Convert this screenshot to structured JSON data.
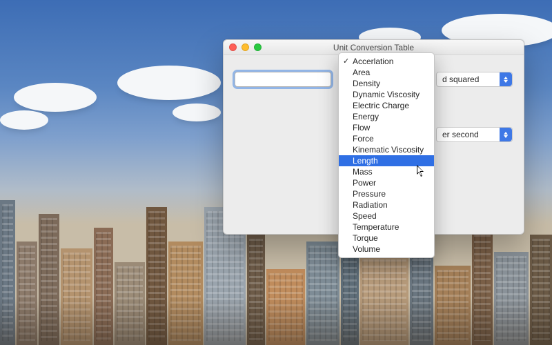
{
  "window": {
    "title": "Unit Conversion Table"
  },
  "selects": {
    "from_unit_visible_tail": "d squared",
    "to_unit_visible_tail": "er second"
  },
  "dropdown": {
    "selected_index": 0,
    "highlight_index": 9,
    "items": [
      "Accerlation",
      "Area",
      "Density",
      "Dynamic Viscosity",
      "Electric Charge",
      "Energy",
      "Flow",
      "Force",
      "Kinematic Viscosity",
      "Length",
      "Mass",
      "Power",
      "Pressure",
      "Radiation",
      "Speed",
      "Temperature",
      "Torque",
      "Volume"
    ]
  }
}
